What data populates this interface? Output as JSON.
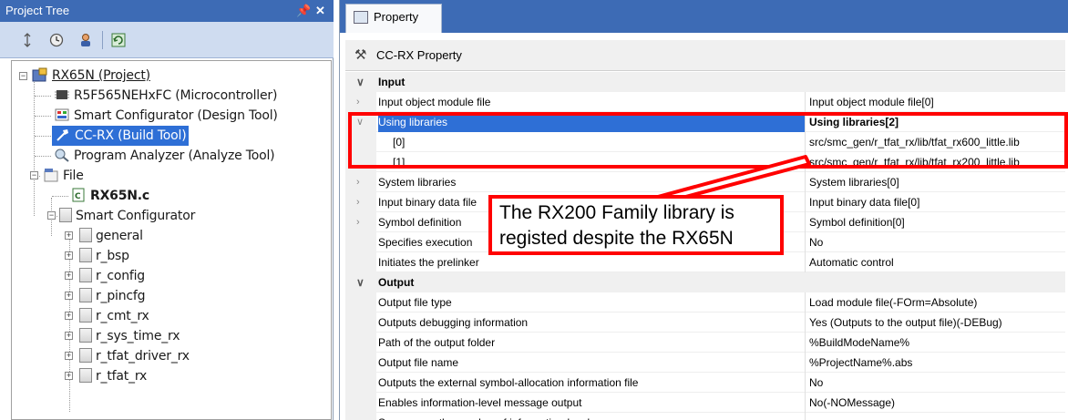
{
  "tree_panel": {
    "title": "Project Tree",
    "pin_glyph": "д",
    "close_glyph": "✕",
    "toolbar_icons": [
      "sort-icon",
      "clock-icon",
      "user-icon",
      "refresh-icon"
    ],
    "nodes": [
      {
        "label": "RX65N (Project)"
      },
      {
        "label": "R5F565NEHxFC (Microcontroller)"
      },
      {
        "label": "Smart Configurator (Design Tool)"
      },
      {
        "label": "CC-RX (Build Tool)"
      },
      {
        "label": "Program Analyzer (Analyze Tool)"
      },
      {
        "label": "File"
      },
      {
        "label": "RX65N.c"
      },
      {
        "label": "Smart Configurator"
      },
      {
        "label": "general"
      },
      {
        "label": "r_bsp"
      },
      {
        "label": "r_config"
      },
      {
        "label": "r_pincfg"
      },
      {
        "label": "r_cmt_rx"
      },
      {
        "label": "r_sys_time_rx"
      },
      {
        "label": "r_tfat_driver_rx"
      },
      {
        "label": "r_tfat_rx"
      }
    ]
  },
  "property_panel": {
    "tab_label": "Property",
    "header": "CC-RX Property",
    "rows": [
      {
        "name": "Input",
        "value": ""
      },
      {
        "name": "Input object module file",
        "value": "Input object module file[0]"
      },
      {
        "name": "Using libraries",
        "value": "Using libraries[2]"
      },
      {
        "name": "[0]",
        "value": "src/smc_gen/r_tfat_rx/lib/tfat_rx600_little.lib"
      },
      {
        "name": "[1]",
        "value": "src/smc_gen/r_tfat_rx/lib/tfat_rx200_little.lib"
      },
      {
        "name": "System libraries",
        "value": "System libraries[0]"
      },
      {
        "name": "Input binary data file",
        "value": "Input binary data file[0]"
      },
      {
        "name": "Symbol definition",
        "value": "Symbol definition[0]"
      },
      {
        "name": "Specifies execution",
        "value": "No"
      },
      {
        "name": "Initiates the prelinker",
        "value": "Automatic control"
      },
      {
        "name": "Output",
        "value": ""
      },
      {
        "name": "Output file type",
        "value": "Load module file(-FOrm=Absolute)"
      },
      {
        "name": "Outputs debugging information",
        "value": "Yes (Outputs to the output file)(-DEBug)"
      },
      {
        "name": "Path of the output folder",
        "value": "%BuildModeName%"
      },
      {
        "name": "Output file name",
        "value": "%ProjectName%.abs"
      },
      {
        "name": "Outputs the external symbol-allocation information file",
        "value": "No"
      },
      {
        "name": "Enables information-level message output",
        "value": "No(-NOMessage)"
      },
      {
        "name": "Suppresses the number of information-level messages",
        "value": ""
      }
    ]
  },
  "annotation": {
    "callout_line1": "The RX200 Family library is",
    "callout_line2": "registed despite the RX65N",
    "color": "#ff0000"
  },
  "colors": {
    "titlebar": "#3d6bb5",
    "selection": "#2e6fd6"
  }
}
